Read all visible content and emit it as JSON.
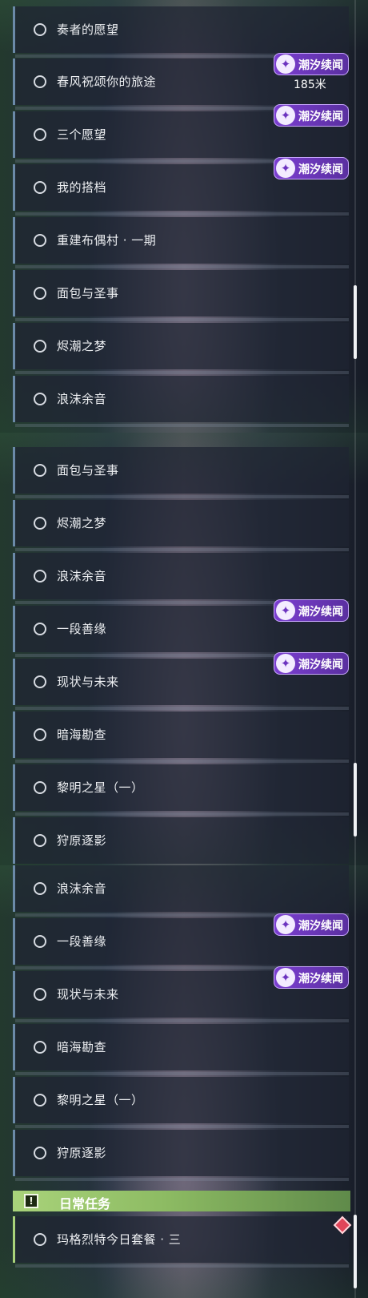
{
  "badge": {
    "icon": "rising-tides-icon",
    "label": "潮汐续闻",
    "color": "#7b3fd0"
  },
  "panel1": {
    "quests": [
      {
        "label": "奏者的愿望"
      },
      {
        "label": "春风祝颂你的旅途",
        "badge": true,
        "distance": "185米"
      },
      {
        "label": "三个愿望",
        "badge": true
      },
      {
        "label": "我的搭档",
        "badge": true
      },
      {
        "label": "重建布偶村 · 一期"
      },
      {
        "label": "面包与圣事"
      },
      {
        "label": "烬潮之梦"
      },
      {
        "label": "浪沫余音"
      }
    ]
  },
  "panel2": {
    "quests": [
      {
        "label": "面包与圣事"
      },
      {
        "label": "烬潮之梦"
      },
      {
        "label": "浪沫余音"
      },
      {
        "label": "一段善缘",
        "badge": true
      },
      {
        "label": "现状与未来",
        "badge": true
      },
      {
        "label": "暗海勘查"
      },
      {
        "label": "黎明之星（一）"
      },
      {
        "label": "狩原逐影"
      }
    ]
  },
  "panel3": {
    "quests": [
      {
        "label": "浪沫余音"
      },
      {
        "label": "一段善缘",
        "badge": true
      },
      {
        "label": "现状与未来",
        "badge": true
      },
      {
        "label": "暗海勘查"
      },
      {
        "label": "黎明之星（一）"
      },
      {
        "label": "狩原逐影"
      }
    ],
    "daily_section": {
      "icon": "exclamation-icon",
      "title": "日常任务",
      "accent": "#a9d37a",
      "quests": [
        {
          "label": "玛格烈特今日套餐 · 三",
          "marker": "red-diamond-icon"
        }
      ]
    }
  }
}
